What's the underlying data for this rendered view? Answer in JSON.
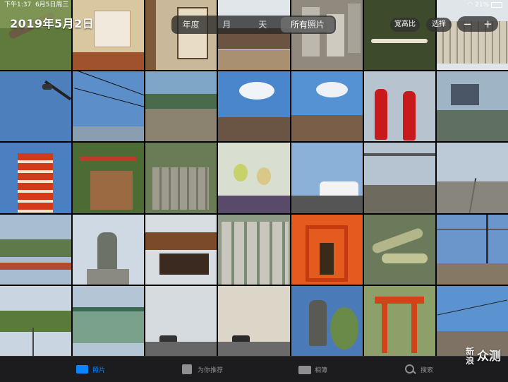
{
  "status_bar": {
    "time": "下午1:37",
    "date": "6月5日周三",
    "battery": "21%"
  },
  "header": {
    "date_title": "2019年5月2日"
  },
  "view_segment": {
    "options": [
      "年度",
      "月",
      "天",
      "所有照片"
    ],
    "selected": "所有照片"
  },
  "toolbar": {
    "aspect_label": "宽高比",
    "select_label": "选择",
    "zoom_out": "−",
    "zoom_in": "+"
  },
  "tab_bar": {
    "tabs": [
      "照片",
      "为你推荐",
      "相簿",
      "搜索"
    ],
    "active": "照片"
  },
  "watermark": {
    "line1": "新",
    "line2": "浪",
    "text": "众测"
  },
  "colors": {
    "accent": "#0a84ff",
    "tab_bar_bg": "#1c1c1e",
    "inactive_tab": "#8e8e93"
  }
}
